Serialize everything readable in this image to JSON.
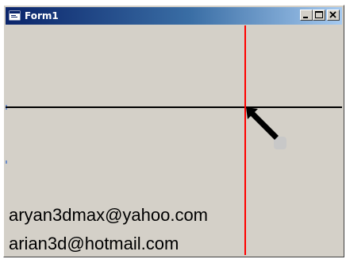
{
  "window": {
    "title": "Form1",
    "icon": "form-icon",
    "caption_buttons": [
      "minimize-icon",
      "maximize-icon",
      "close-icon"
    ]
  },
  "client": {
    "emails": [
      "aryan3dmax@yahoo.com",
      "arian3d@hotmail.com"
    ],
    "colors": {
      "background": "#d4d0c8",
      "horizontal_line": "#000000",
      "vertical_line": "#ff0000",
      "arrow": "#000000"
    }
  }
}
